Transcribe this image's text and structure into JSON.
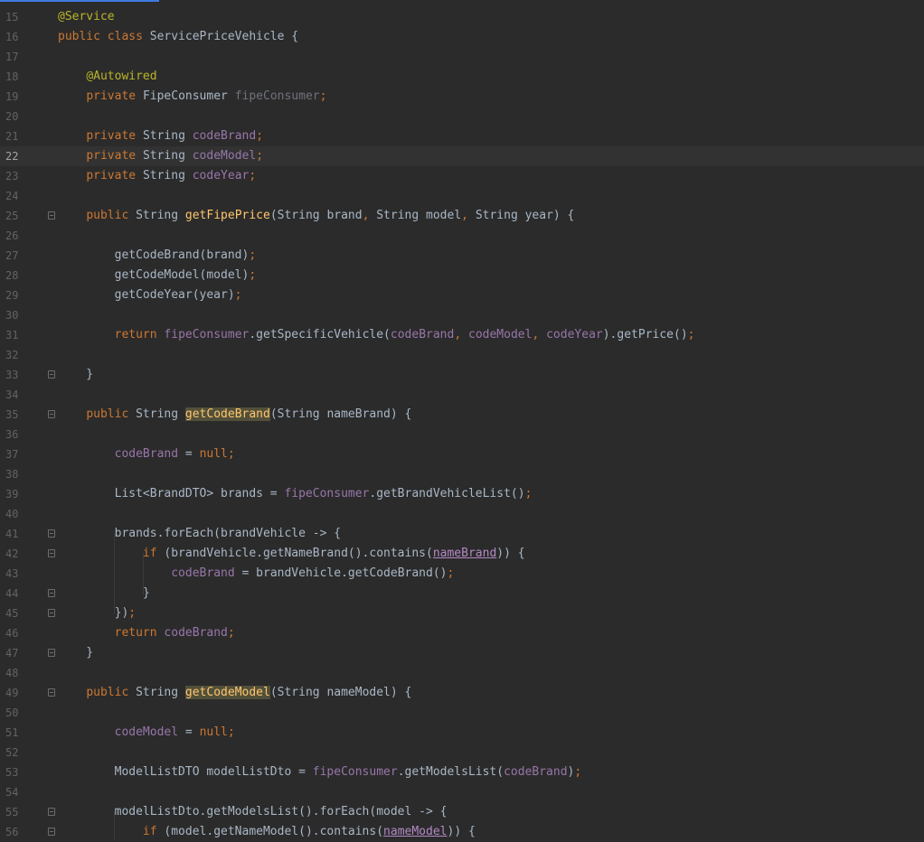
{
  "editor": {
    "current_line": 22,
    "lines": [
      {
        "n": "15",
        "fold": false,
        "tokens": [
          [
            "ann",
            "@Service"
          ]
        ]
      },
      {
        "n": "16",
        "fold": false,
        "tokens": [
          [
            "kw",
            "public class "
          ],
          [
            "pl",
            "ServicePriceVehicle {"
          ]
        ]
      },
      {
        "n": "17",
        "fold": false,
        "tokens": []
      },
      {
        "n": "18",
        "fold": false,
        "tokens": [
          [
            "pl",
            "    "
          ],
          [
            "ann",
            "@Autowired"
          ]
        ]
      },
      {
        "n": "19",
        "fold": false,
        "tokens": [
          [
            "pl",
            "    "
          ],
          [
            "kw",
            "private "
          ],
          [
            "pl",
            "FipeConsumer "
          ],
          [
            "gr",
            "fipeConsumer"
          ],
          [
            "kw",
            ";"
          ]
        ]
      },
      {
        "n": "20",
        "fold": false,
        "tokens": []
      },
      {
        "n": "21",
        "fold": false,
        "tokens": [
          [
            "pl",
            "    "
          ],
          [
            "kw",
            "private "
          ],
          [
            "pl",
            "String "
          ],
          [
            "fld",
            "codeBrand"
          ],
          [
            "kw",
            ";"
          ]
        ]
      },
      {
        "n": "22",
        "fold": false,
        "tokens": [
          [
            "pl",
            "    "
          ],
          [
            "kw",
            "private "
          ],
          [
            "pl",
            "String "
          ],
          [
            "fld",
            "codeModel"
          ],
          [
            "kw",
            ";"
          ]
        ]
      },
      {
        "n": "23",
        "fold": false,
        "tokens": [
          [
            "pl",
            "    "
          ],
          [
            "kw",
            "private "
          ],
          [
            "pl",
            "String "
          ],
          [
            "fld",
            "codeYear"
          ],
          [
            "kw",
            ";"
          ]
        ]
      },
      {
        "n": "24",
        "fold": false,
        "tokens": []
      },
      {
        "n": "25",
        "fold": true,
        "tokens": [
          [
            "pl",
            "    "
          ],
          [
            "kw",
            "public "
          ],
          [
            "pl",
            "String "
          ],
          [
            "fn",
            "getFipePrice"
          ],
          [
            "pl",
            "(String brand"
          ],
          [
            "kw",
            ", "
          ],
          [
            "pl",
            "String model"
          ],
          [
            "kw",
            ", "
          ],
          [
            "pl",
            "String year) {"
          ]
        ]
      },
      {
        "n": "26",
        "fold": false,
        "tokens": []
      },
      {
        "n": "27",
        "fold": false,
        "tokens": [
          [
            "pl",
            "        getCodeBrand(brand)"
          ],
          [
            "kw",
            ";"
          ]
        ]
      },
      {
        "n": "28",
        "fold": false,
        "tokens": [
          [
            "pl",
            "        getCodeModel(model)"
          ],
          [
            "kw",
            ";"
          ]
        ]
      },
      {
        "n": "29",
        "fold": false,
        "tokens": [
          [
            "pl",
            "        getCodeYear(year)"
          ],
          [
            "kw",
            ";"
          ]
        ]
      },
      {
        "n": "30",
        "fold": false,
        "tokens": []
      },
      {
        "n": "31",
        "fold": false,
        "tokens": [
          [
            "pl",
            "        "
          ],
          [
            "kw",
            "return "
          ],
          [
            "fld",
            "fipeConsumer"
          ],
          [
            "pl",
            ".getSpecificVehicle("
          ],
          [
            "fld",
            "codeBrand"
          ],
          [
            "kw",
            ", "
          ],
          [
            "fld",
            "codeModel"
          ],
          [
            "kw",
            ", "
          ],
          [
            "fld",
            "codeYear"
          ],
          [
            "pl",
            ").getPrice()"
          ],
          [
            "kw",
            ";"
          ]
        ]
      },
      {
        "n": "32",
        "fold": false,
        "tokens": []
      },
      {
        "n": "33",
        "fold": true,
        "tokens": [
          [
            "pl",
            "    }"
          ]
        ]
      },
      {
        "n": "34",
        "fold": false,
        "tokens": []
      },
      {
        "n": "35",
        "fold": true,
        "tokens": [
          [
            "pl",
            "    "
          ],
          [
            "kw",
            "public "
          ],
          [
            "pl",
            "String "
          ],
          [
            "hl",
            "getCodeBrand"
          ],
          [
            "pl",
            "(String nameBrand) {"
          ]
        ]
      },
      {
        "n": "36",
        "fold": false,
        "tokens": []
      },
      {
        "n": "37",
        "fold": false,
        "tokens": [
          [
            "pl",
            "        "
          ],
          [
            "fld",
            "codeBrand"
          ],
          [
            "pl",
            " = "
          ],
          [
            "kw",
            "null;"
          ]
        ]
      },
      {
        "n": "38",
        "fold": false,
        "tokens": []
      },
      {
        "n": "39",
        "fold": false,
        "tokens": [
          [
            "pl",
            "        List<BrandDTO> brands = "
          ],
          [
            "fld",
            "fipeConsumer"
          ],
          [
            "pl",
            ".getBrandVehicleList()"
          ],
          [
            "kw",
            ";"
          ]
        ]
      },
      {
        "n": "40",
        "fold": false,
        "tokens": []
      },
      {
        "n": "41",
        "fold": true,
        "tokens": [
          [
            "pl",
            "        brands.forEach(brandVehicle -> {"
          ]
        ]
      },
      {
        "n": "42",
        "fold": true,
        "tokens": [
          [
            "pl",
            "            "
          ],
          [
            "kw",
            "if "
          ],
          [
            "pl",
            "(brandVehicle.getNameBrand().contains("
          ],
          [
            "ul",
            "nameBrand"
          ],
          [
            "pl",
            ")) {"
          ]
        ]
      },
      {
        "n": "43",
        "fold": false,
        "tokens": [
          [
            "pl",
            "                "
          ],
          [
            "fld",
            "codeBrand"
          ],
          [
            "pl",
            " = brandVehicle.getCodeBrand()"
          ],
          [
            "kw",
            ";"
          ]
        ]
      },
      {
        "n": "44",
        "fold": true,
        "tokens": [
          [
            "pl",
            "            }"
          ]
        ]
      },
      {
        "n": "45",
        "fold": true,
        "tokens": [
          [
            "pl",
            "        })"
          ],
          [
            "kw",
            ";"
          ]
        ]
      },
      {
        "n": "46",
        "fold": false,
        "tokens": [
          [
            "pl",
            "        "
          ],
          [
            "kw",
            "return "
          ],
          [
            "fld",
            "codeBrand"
          ],
          [
            "kw",
            ";"
          ]
        ]
      },
      {
        "n": "47",
        "fold": true,
        "tokens": [
          [
            "pl",
            "    }"
          ]
        ]
      },
      {
        "n": "48",
        "fold": false,
        "tokens": []
      },
      {
        "n": "49",
        "fold": true,
        "tokens": [
          [
            "pl",
            "    "
          ],
          [
            "kw",
            "public "
          ],
          [
            "pl",
            "String "
          ],
          [
            "hl",
            "getCodeModel"
          ],
          [
            "pl",
            "(String nameModel) {"
          ]
        ]
      },
      {
        "n": "50",
        "fold": false,
        "tokens": []
      },
      {
        "n": "51",
        "fold": false,
        "tokens": [
          [
            "pl",
            "        "
          ],
          [
            "fld",
            "codeModel"
          ],
          [
            "pl",
            " = "
          ],
          [
            "kw",
            "null;"
          ]
        ]
      },
      {
        "n": "52",
        "fold": false,
        "tokens": []
      },
      {
        "n": "53",
        "fold": false,
        "tokens": [
          [
            "pl",
            "        ModelListDTO modelListDto = "
          ],
          [
            "fld",
            "fipeConsumer"
          ],
          [
            "pl",
            ".getModelsList("
          ],
          [
            "fld",
            "codeBrand"
          ],
          [
            "pl",
            ")"
          ],
          [
            "kw",
            ";"
          ]
        ]
      },
      {
        "n": "54",
        "fold": false,
        "tokens": []
      },
      {
        "n": "55",
        "fold": true,
        "tokens": [
          [
            "pl",
            "        modelListDto.getModelsList().forEach(model -> {"
          ]
        ]
      },
      {
        "n": "56",
        "fold": true,
        "tokens": [
          [
            "pl",
            "            "
          ],
          [
            "kw",
            "if "
          ],
          [
            "pl",
            "(model.getNameModel().contains("
          ],
          [
            "ul",
            "nameModel"
          ],
          [
            "pl",
            ")) {"
          ]
        ]
      }
    ]
  }
}
